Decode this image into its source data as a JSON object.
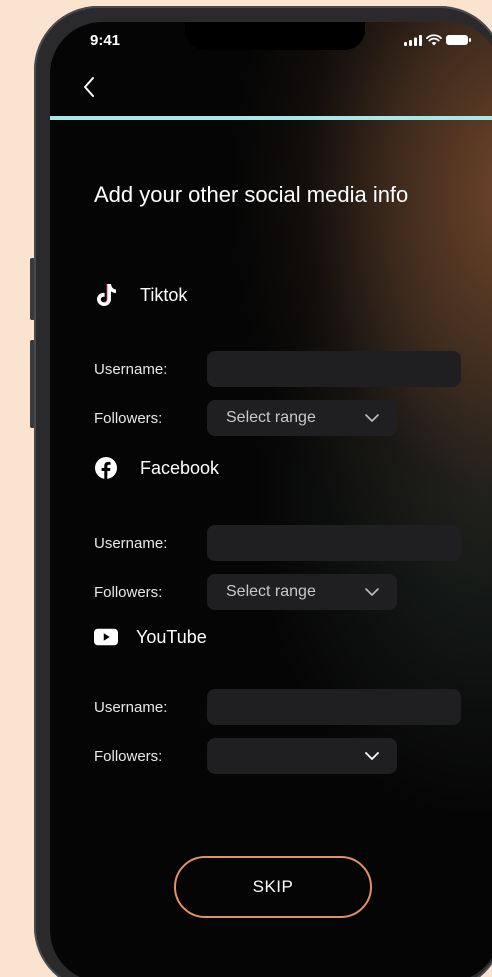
{
  "status": {
    "time": "9:41"
  },
  "header": {
    "progress_percent": 100
  },
  "title": "Add your other social media info",
  "sections": [
    {
      "name": "Tiktok",
      "icon": "tiktok-icon",
      "username_label": "Username:",
      "username_value": "",
      "followers_label": "Followers:",
      "followers_value": "Select range"
    },
    {
      "name": "Facebook",
      "icon": "facebook-icon",
      "username_label": "Username:",
      "username_value": "",
      "followers_label": "Followers:",
      "followers_value": "Select range"
    },
    {
      "name": "YouTube",
      "icon": "youtube-icon",
      "username_label": "Username:",
      "username_value": "",
      "followers_label": "Followers:",
      "followers_value": ""
    }
  ],
  "skip_label": "SKIP",
  "colors": {
    "accent_progress": "#a9e6e6",
    "skip_border": "#e0906a",
    "field_bg": "#1f1f21"
  }
}
